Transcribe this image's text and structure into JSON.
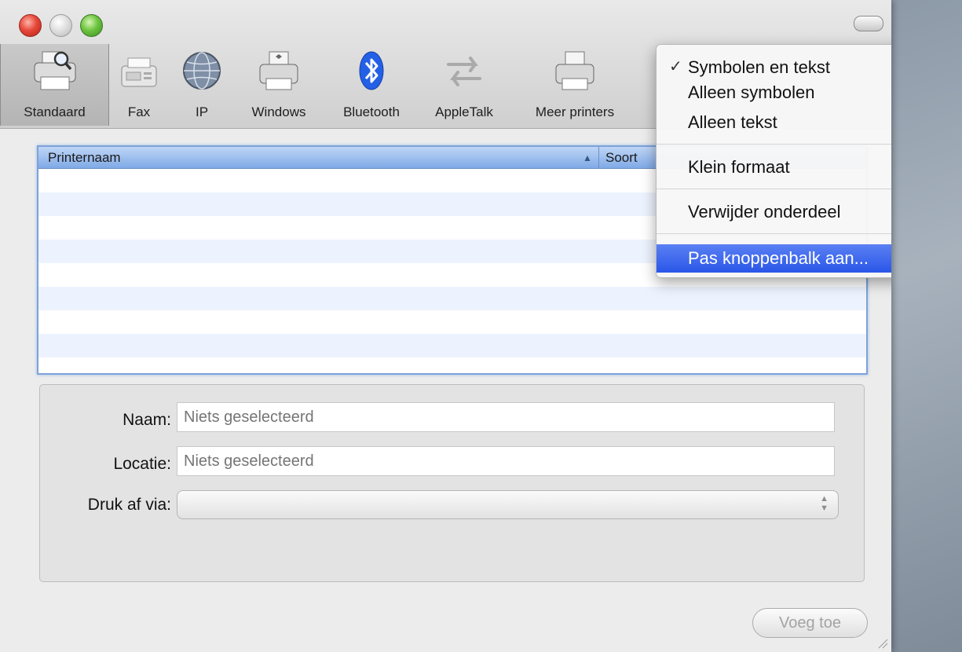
{
  "window": {
    "controls": [
      "close",
      "minimize",
      "zoom"
    ]
  },
  "toolbar": {
    "items": [
      {
        "label": "Standaard",
        "icon": "printer-magnifier-icon",
        "selected": true
      },
      {
        "label": "Fax",
        "icon": "fax-icon"
      },
      {
        "label": "IP",
        "icon": "globe-icon"
      },
      {
        "label": "Windows",
        "icon": "windows-printer-icon"
      },
      {
        "label": "Bluetooth",
        "icon": "bluetooth-icon"
      },
      {
        "label": "AppleTalk",
        "icon": "appletalk-arrows-icon"
      },
      {
        "label": "Meer printers",
        "icon": "printer-icon"
      }
    ]
  },
  "printer_table": {
    "columns": [
      "Printernaam",
      "Soort"
    ],
    "sort_indicator": "▲",
    "rows": []
  },
  "details": {
    "name_label": "Naam:",
    "name_placeholder": "Niets geselecteerd",
    "location_label": "Locatie:",
    "location_placeholder": "Niets geselecteerd",
    "print_via_label": "Druk af via:",
    "print_via_value": ""
  },
  "add_button": "Voeg toe",
  "context_menu": {
    "items": [
      {
        "label": "Symbolen en tekst",
        "checked": true
      },
      {
        "label": "Alleen symbolen"
      },
      {
        "label": "Alleen tekst"
      },
      {
        "label": "Klein formaat"
      },
      {
        "label": "Verwijder onderdeel"
      },
      {
        "label": "Pas knoppenbalk aan...",
        "highlighted": true
      }
    ],
    "check_glyph": "✓",
    "highlight_color": "#3b66ee"
  }
}
